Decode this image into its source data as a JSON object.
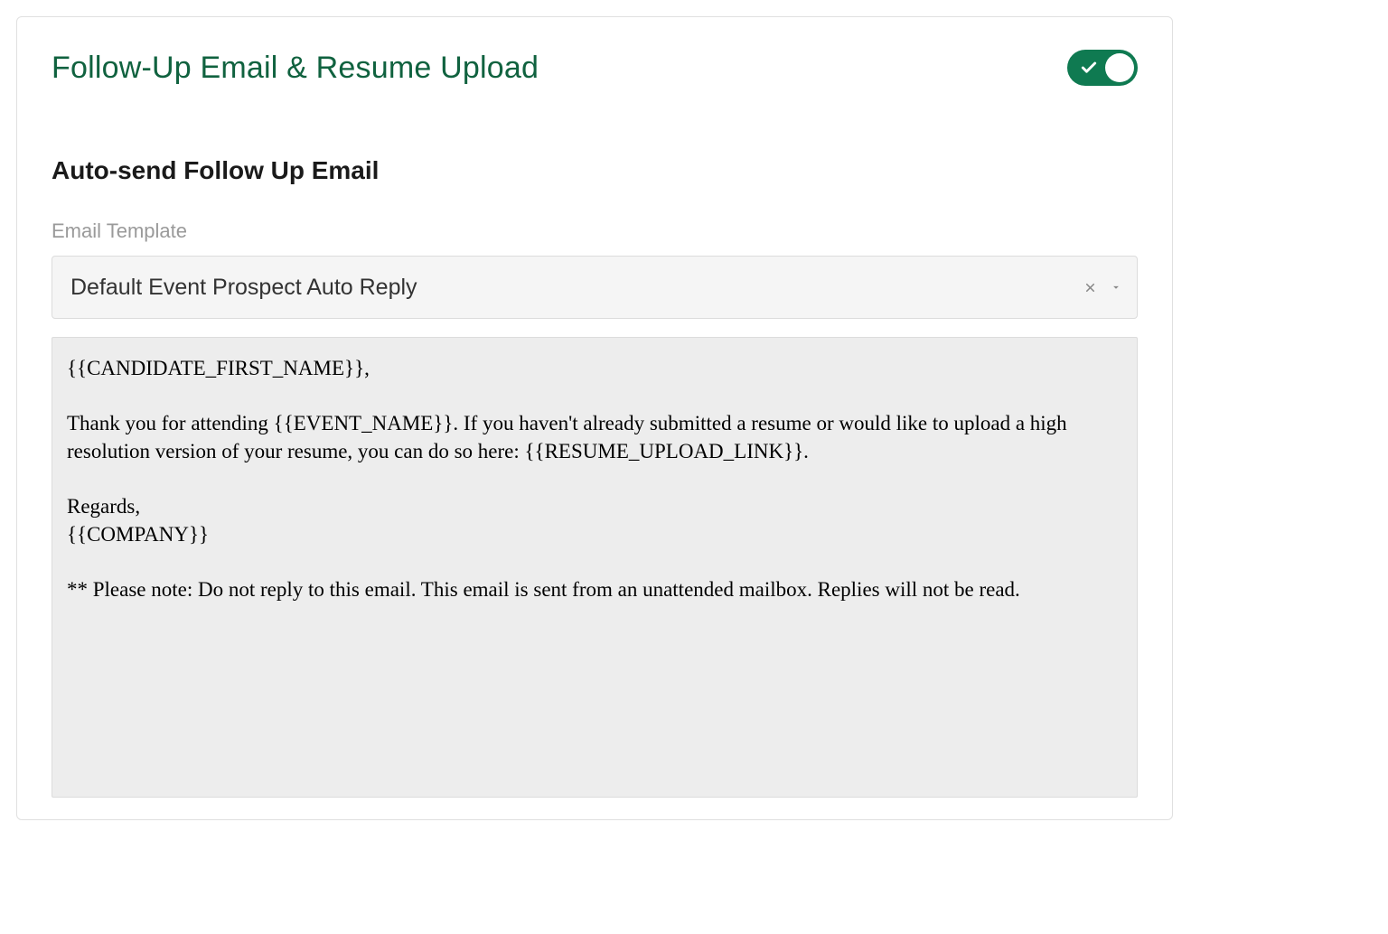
{
  "header": {
    "title": "Follow-Up Email & Resume Upload",
    "toggle_on": true
  },
  "section": {
    "subtitle": "Auto-send Follow Up Email",
    "field_label": "Email Template",
    "template_select": {
      "selected": "Default Event Prospect Auto Reply"
    },
    "preview": {
      "greeting": "{{CANDIDATE_FIRST_NAME}},",
      "body": "Thank you for attending {{EVENT_NAME}}. If you haven't already submitted a resume or would like to upload a high resolution version of your resume, you can do so here: {{RESUME_UPLOAD_LINK}}.",
      "signoff": "Regards,",
      "company": "{{COMPANY}}",
      "note": "** Please note: Do not reply to this email. This email is sent from an unattended mailbox. Replies will not be read."
    }
  }
}
